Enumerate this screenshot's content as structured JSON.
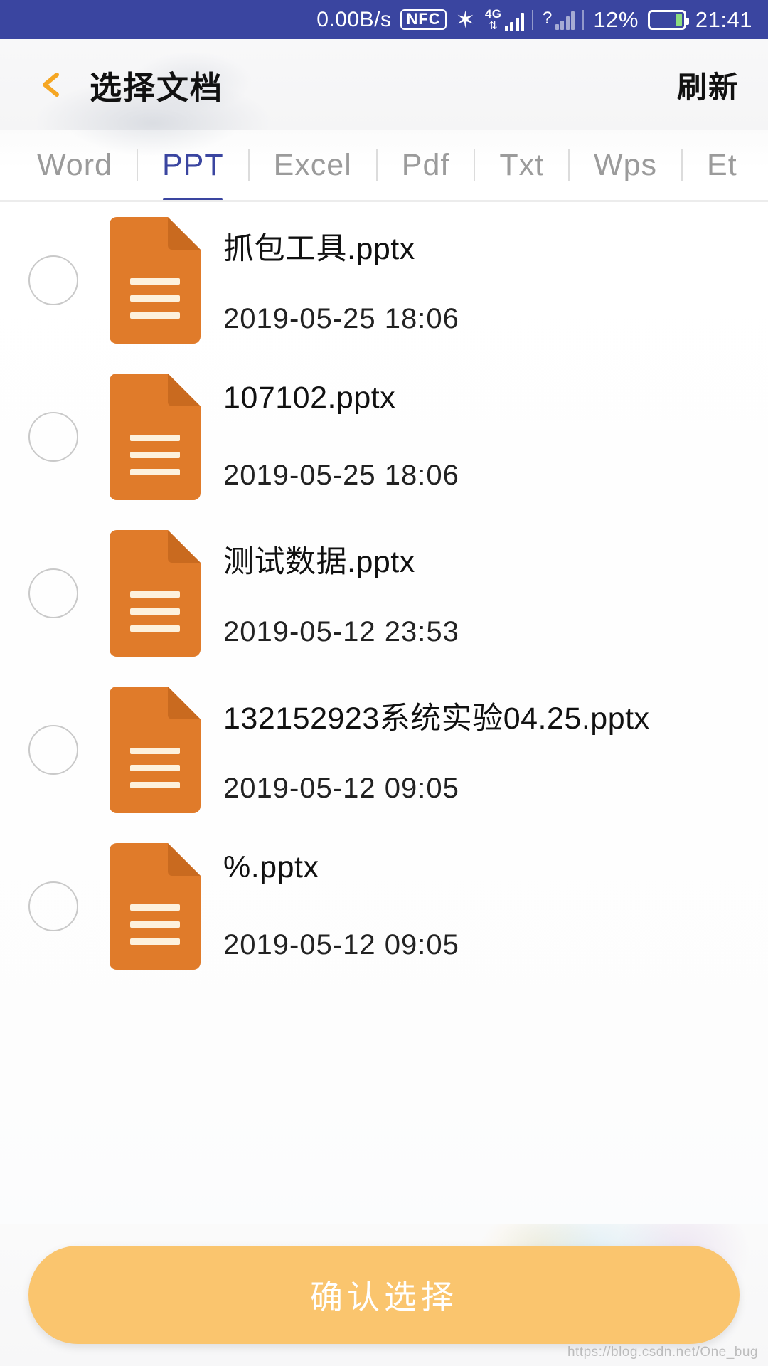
{
  "status_bar": {
    "network_speed": "0.00B/s",
    "nfc_label": "NFC",
    "bluetooth_icon": "bluetooth-icon",
    "sim1_network": "4G",
    "sim2_unknown": "?",
    "battery_percent": "12%",
    "clock": "21:41",
    "background_color": "#3a45a0"
  },
  "header": {
    "back_icon": "chevron-left-icon",
    "back_icon_color": "#f5a623",
    "title": "选择文档",
    "action_label": "刷新"
  },
  "tabs": {
    "active_index": 1,
    "active_color": "#3a45a0",
    "inactive_color": "#9b9b9b",
    "items": [
      {
        "label": "Word"
      },
      {
        "label": "PPT"
      },
      {
        "label": "Excel"
      },
      {
        "label": "Pdf"
      },
      {
        "label": "Txt"
      },
      {
        "label": "Wps"
      },
      {
        "label": "Et"
      }
    ]
  },
  "file_list": {
    "icon_color": "#e07b2a",
    "icon_fold_color": "#c96a1f",
    "icon_line_color": "#fdf1dd",
    "icon_label": "PPT",
    "rows": [
      {
        "name": "抓包工具.pptx",
        "date": "2019-05-25 18:06",
        "checked": false
      },
      {
        "name": "107102.pptx",
        "date": "2019-05-25 18:06",
        "checked": false
      },
      {
        "name": "测试数据.pptx",
        "date": "2019-05-12 23:53",
        "checked": false
      },
      {
        "name": "132152923系统实验04.25.pptx",
        "date": "2019-05-12 09:05",
        "checked": false
      },
      {
        "name": "%.pptx",
        "date": "2019-05-12 09:05",
        "checked": false
      }
    ]
  },
  "bottom": {
    "confirm_label": "确认选择",
    "confirm_color": "#fac56e",
    "watermark": "https://blog.csdn.net/One_bug"
  }
}
